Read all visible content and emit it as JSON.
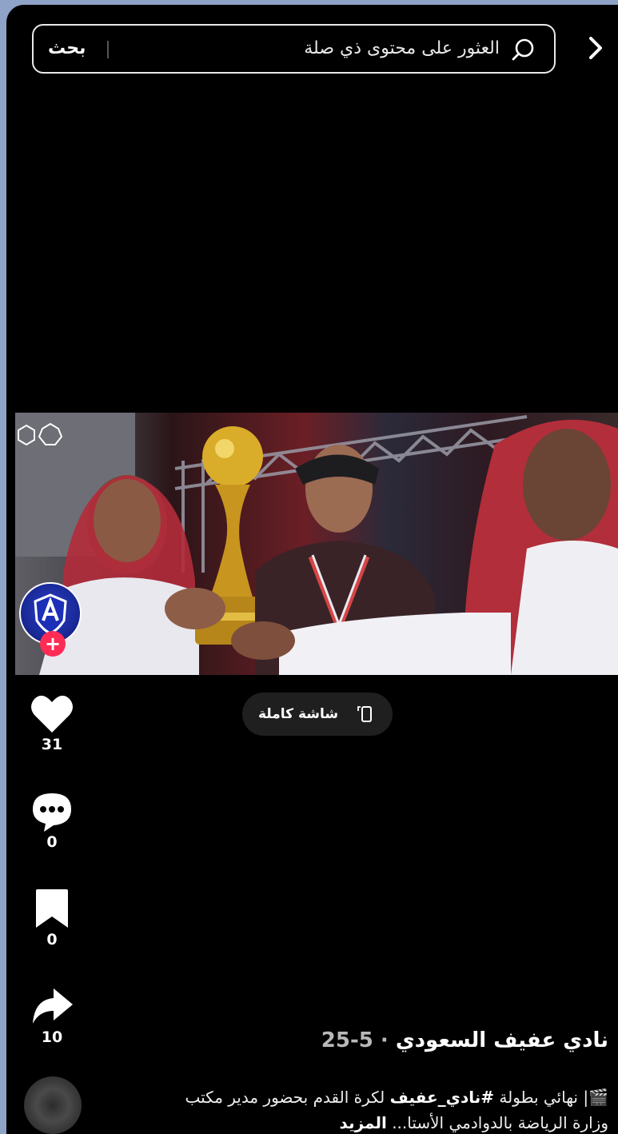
{
  "search": {
    "button_label": "بحث",
    "placeholder": "العثور على محتوى ذي صلة"
  },
  "fullscreen": {
    "label": "شاشة كاملة"
  },
  "actions": {
    "likes": "31",
    "comments": "0",
    "saves": "0",
    "shares": "10"
  },
  "post": {
    "author": "نادي عفيف السعودي",
    "date": "5-25",
    "separator": " · ",
    "caption_prefix": "🎬| نهائي بطولة ",
    "hashtag": "#نادي_عفيف",
    "caption_rest": " لكرة القدم بحضور مدير مكتب وزارة الرياضة بالدوادمي الأستا...",
    "more": "المزيد"
  },
  "colors": {
    "background": "#000000",
    "page_border": "#8fa3c9",
    "follow_plus": "#fe2c55",
    "pill": "#1f1f1f"
  }
}
